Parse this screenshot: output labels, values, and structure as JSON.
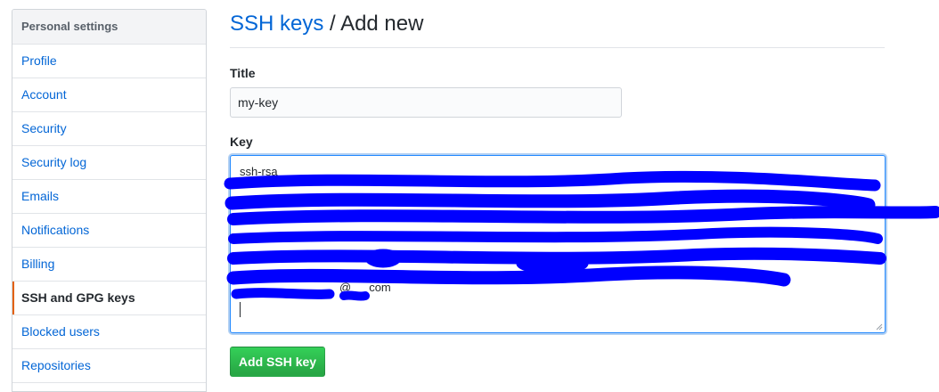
{
  "sidebar": {
    "header": "Personal settings",
    "items": [
      {
        "label": "Profile"
      },
      {
        "label": "Account"
      },
      {
        "label": "Security"
      },
      {
        "label": "Security log"
      },
      {
        "label": "Emails"
      },
      {
        "label": "Notifications"
      },
      {
        "label": "Billing"
      },
      {
        "label": "SSH and GPG keys",
        "selected": true
      },
      {
        "label": "Blocked users"
      },
      {
        "label": "Repositories"
      }
    ]
  },
  "header": {
    "breadcrumb_link": "SSH keys",
    "separator": " / ",
    "current": "Add new"
  },
  "form": {
    "title_label": "Title",
    "title_value": "my-key",
    "key_label": "Key",
    "key_value": "ssh-rsa",
    "key_email_suffix": "@",
    "key_email_domain": "com",
    "submit_label": "Add SSH key"
  },
  "colors": {
    "link": "#0366d6",
    "selected_marker": "#e36209",
    "button_green": "#28a745",
    "redaction": "#0000ff"
  }
}
